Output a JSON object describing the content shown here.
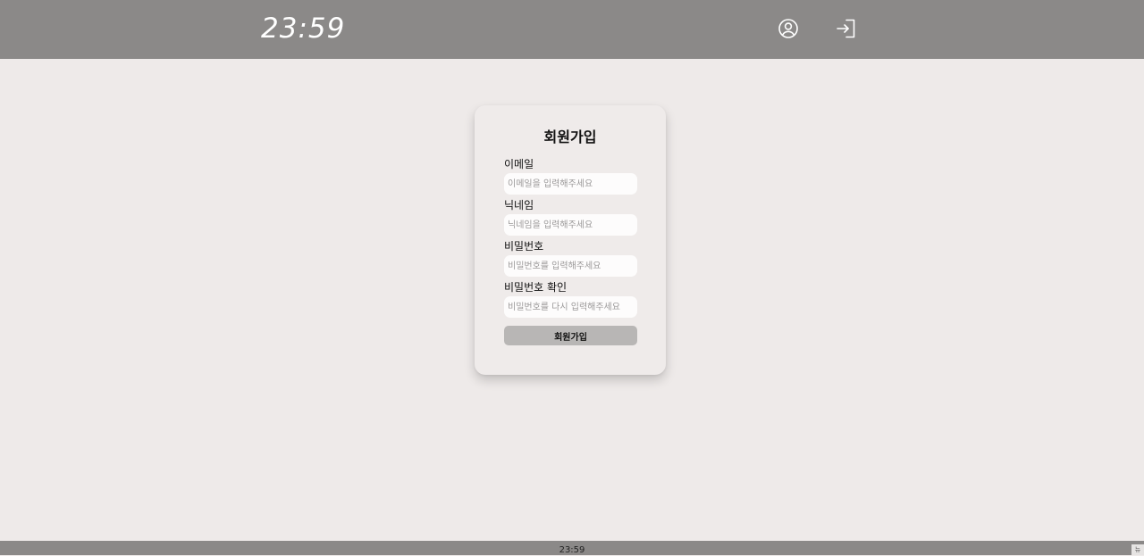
{
  "header": {
    "logo_text": "23:59",
    "profile_icon": "user-circle-icon",
    "login_icon": "login-icon"
  },
  "signup": {
    "title": "회원가입",
    "email": {
      "label": "이메일",
      "placeholder": "이메일을 입력해주세요"
    },
    "nickname": {
      "label": "닉네임",
      "placeholder": "닉네임을 입력해주세요"
    },
    "password": {
      "label": "비밀번호",
      "placeholder": "비밀번호를 입력해주세요"
    },
    "password_confirm": {
      "label": "비밀번호 확인",
      "placeholder": "비밀번호를 다시 입력해주세요"
    },
    "submit_label": "회원가입"
  },
  "footer": {
    "text": "23:59",
    "corner_text": "뉴"
  },
  "colors": {
    "header_bg": "#8b8988",
    "page_bg": "#eeeae9",
    "button_bg": "#b8b6b5"
  }
}
